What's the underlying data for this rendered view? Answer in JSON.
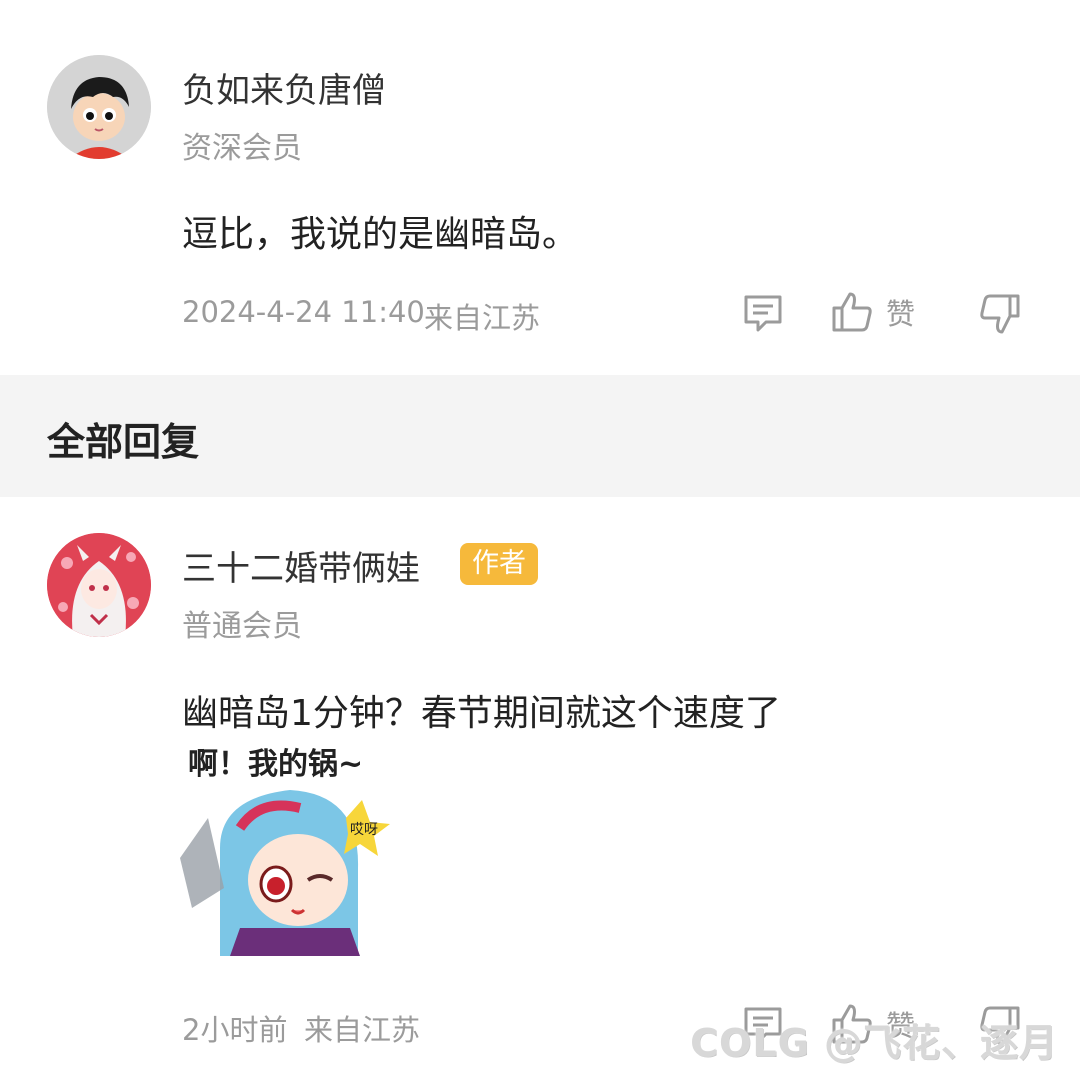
{
  "post": {
    "user_name": "负如来负唐僧",
    "user_level": "资深会员",
    "content": "逗比，我说的是幽暗岛。",
    "timestamp": "2024-4-24 11:40",
    "location": "来自江苏",
    "like_label": "赞"
  },
  "section": {
    "title": "全部回复"
  },
  "reply": {
    "user_name": "三十二婚带俩娃",
    "badge": "作者",
    "user_level": "普通会员",
    "content": "幽暗岛1分钟？春节期间就这个速度了",
    "sticker_text": "啊！我的锅~",
    "sticker_sub": "哎呀",
    "timestamp": "2小时前",
    "location": "来自江苏",
    "like_label": "赞"
  },
  "watermark": "COLG @飞花、逐月",
  "colors": {
    "badge": "#f6b93b",
    "section_bg": "#f4f4f4",
    "meta_gray": "#9b9b9b"
  }
}
